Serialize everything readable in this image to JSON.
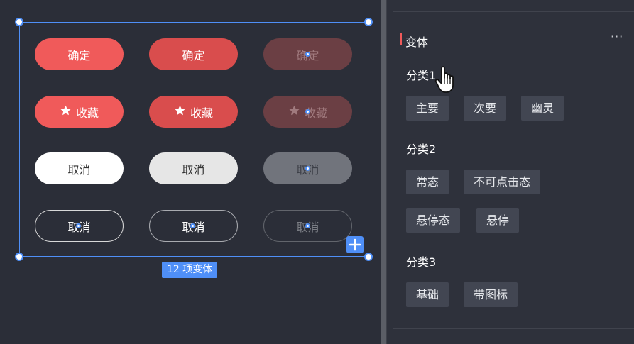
{
  "canvas": {
    "variant_count_label": "12 项变体",
    "buttons": {
      "row1": [
        "确定",
        "确定",
        "确定"
      ],
      "row2": [
        "收藏",
        "收藏",
        "收藏"
      ],
      "row3": [
        "取消",
        "取消",
        "取消"
      ],
      "row4": [
        "取消",
        "取消",
        "取消"
      ]
    },
    "icons": {
      "star": "star-icon",
      "add": "plus-icon"
    }
  },
  "panel": {
    "title": "变体",
    "more": "···",
    "categories": [
      {
        "label": "分类1",
        "tags": [
          "主要",
          "次要",
          "幽灵"
        ]
      },
      {
        "label": "分类2",
        "tags": [
          "常态",
          "不可点击态",
          "悬停态",
          "悬停"
        ]
      },
      {
        "label": "分类3",
        "tags": [
          "基础",
          "带图标"
        ]
      }
    ]
  },
  "colors": {
    "accent": "#4f8ff7",
    "primary_red": "#f05a5a",
    "background": "#2b2e38",
    "tag_bg": "#424652"
  }
}
